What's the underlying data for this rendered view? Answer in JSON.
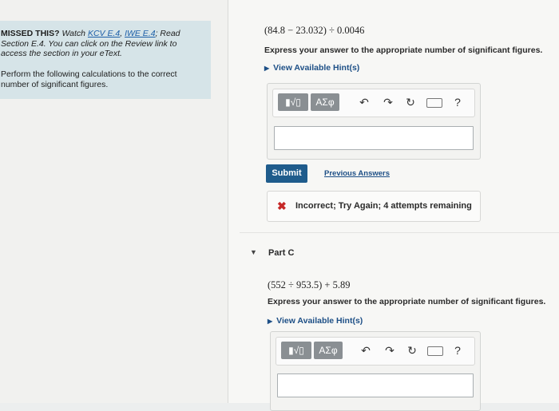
{
  "left": {
    "missed": {
      "lead": "MISSED THIS?",
      "watch": "Watch",
      "link1": "KCV E.4",
      "sep": ",",
      "link2": "IWE E.4",
      "rest": "; Read Section E.4. You can click on the Review link to access the section in your eText."
    },
    "instructions": "Perform the following calculations to the correct number of significant figures."
  },
  "part_b": {
    "expression": "(84.8 − 23.032) ÷ 0.0046",
    "prompt": "Express your answer to the appropriate number of significant figures.",
    "hint": "View Available Hint(s)",
    "answer_value": "",
    "submit_label": "Submit",
    "previous_answers": "Previous Answers",
    "feedback": "Incorrect; Try Again; 4 attempts remaining"
  },
  "part_c": {
    "title": "Part C",
    "expression": "(552 ÷ 953.5) + 5.89",
    "prompt": "Express your answer to the appropriate number of significant figures.",
    "hint": "View Available Hint(s)",
    "answer_value": ""
  },
  "toolbar": {
    "templates_label": "▮√▯",
    "symbols_label": "ΑΣφ",
    "undo_icon": "↶",
    "redo_icon": "↷",
    "reset_icon": "↻",
    "keyboard_icon": "keyboard",
    "help_label": "?"
  },
  "colors": {
    "accent": "#1f5c8c",
    "link": "#1d4f86",
    "info_bg": "#d6e4e8",
    "error": "#c62828"
  }
}
